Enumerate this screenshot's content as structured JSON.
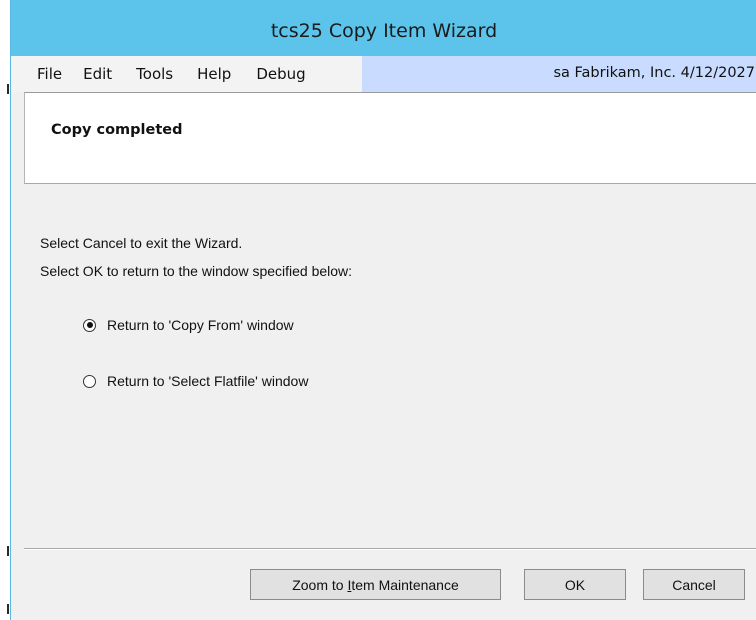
{
  "window": {
    "title": "tcs25 Copy Item Wizard"
  },
  "menu": {
    "items": [
      "File",
      "Edit",
      "Tools",
      "Help",
      "Debug"
    ]
  },
  "status": {
    "text": "sa  Fabrikam, Inc.  4/12/2027"
  },
  "header": {
    "title": "Copy completed"
  },
  "instructions": {
    "line1": "Select Cancel to exit the Wizard.",
    "line2": "Select OK to return to the window specified below:"
  },
  "options": [
    {
      "label": "Return to 'Copy From' window",
      "selected": true
    },
    {
      "label": "Return to 'Select Flatfile' window",
      "selected": false
    }
  ],
  "buttons": {
    "zoom_pre": "Zoom to ",
    "zoom_mnemonic": "I",
    "zoom_post": "tem Maintenance",
    "ok": "OK",
    "cancel": "Cancel"
  },
  "colors": {
    "titlebar": "#5cc3ea",
    "status_area": "#c9dcff",
    "window_bg": "#f0f0f0"
  }
}
